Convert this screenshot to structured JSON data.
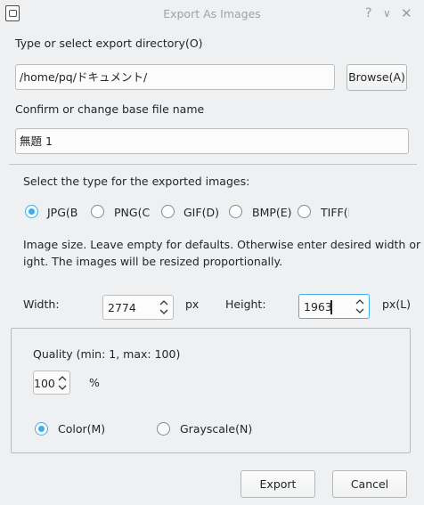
{
  "window": {
    "title": "Export As Images",
    "help_glyph": "?",
    "minimize_glyph": "∨",
    "close_glyph": "✕"
  },
  "directory": {
    "label": "Type or select export directory(O)",
    "value": "/home/pq/ドキュメント/",
    "browse_label": "Browse(A)"
  },
  "basename": {
    "label": "Confirm or change base file name",
    "value": "無題 1"
  },
  "type_section": {
    "label": "Select the type for the exported images:",
    "options": [
      {
        "label": "JPG(B",
        "checked": true
      },
      {
        "label": "PNG(C",
        "checked": false
      },
      {
        "label": "GIF(D)",
        "checked": false
      },
      {
        "label": "BMP(E)",
        "checked": false
      },
      {
        "label": "TIFF(I",
        "checked": false
      }
    ]
  },
  "size_info": {
    "line1": "Image size. Leave empty for defaults. Otherwise enter desired width or he",
    "line2": "ight. The images will be resized proportionally."
  },
  "dimensions": {
    "width_label": "Width:",
    "width_value": "2774",
    "width_unit": "px",
    "height_label": "Height:",
    "height_value": "1963",
    "height_unit": "px(L)"
  },
  "quality": {
    "label": "Quality (min: 1, max: 100)",
    "value": "100",
    "unit": "%"
  },
  "color_mode": {
    "options": [
      {
        "label": "Color(M)",
        "checked": true
      },
      {
        "label": "Grayscale(N)",
        "checked": false
      }
    ]
  },
  "footer": {
    "export_label": "Export",
    "cancel_label": "Cancel"
  },
  "colors": {
    "accent": "#3daee9",
    "window_bg": "#eff0f1",
    "field_bg": "#fcfcfc"
  }
}
